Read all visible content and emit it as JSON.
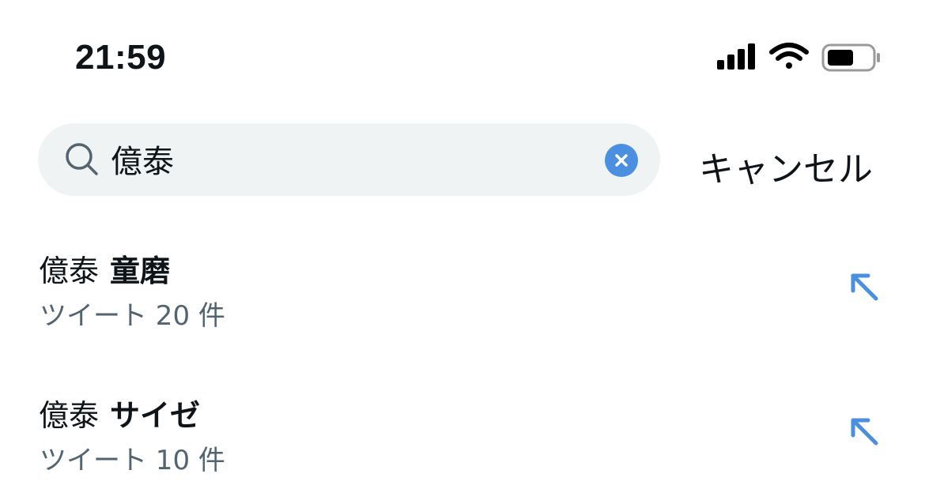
{
  "status_bar": {
    "time": "21:59",
    "icons": [
      "cellular-signal-icon",
      "wifi-icon",
      "battery-icon"
    ]
  },
  "search": {
    "query": "億泰",
    "cancel_label": "キャンセル",
    "icons": [
      "search-icon",
      "clear-icon"
    ]
  },
  "suggestions": [
    {
      "query_part": "億泰",
      "completion": "童磨",
      "count_text": "ツイート 20 件"
    },
    {
      "query_part": "億泰",
      "completion": "サイゼ",
      "count_text": "ツイート 10 件"
    }
  ],
  "colors": {
    "accent": "#4a8fe0",
    "search_bg": "#eff3f4",
    "secondary_text": "#536471",
    "primary_text": "#0f1419"
  }
}
